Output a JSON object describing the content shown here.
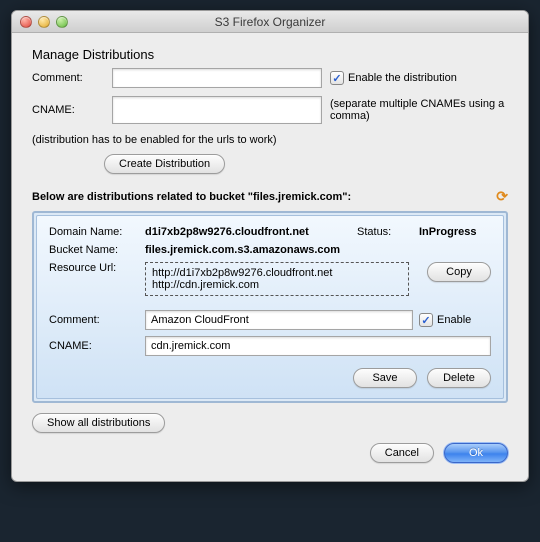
{
  "window": {
    "title": "S3 Firefox Organizer"
  },
  "section": {
    "title": "Manage Distributions"
  },
  "form": {
    "comment_label": "Comment:",
    "comment_value": "",
    "enable_label": "Enable the distribution",
    "cname_label": "CNAME:",
    "cname_value": "",
    "cname_hint": "(separate multiple CNAMEs using a comma)",
    "note": "(distribution has to be enabled for the urls to work)",
    "create_btn": "Create Distribution"
  },
  "list": {
    "title_prefix": "Below are distributions related to bucket \"",
    "bucket": "files.jremick.com",
    "title_suffix": "\":"
  },
  "dist": {
    "domain_label": "Domain Name:",
    "domain_value": "d1i7xb2p8w9276.cloudfront.net",
    "status_label": "Status:",
    "status_value": "InProgress",
    "bucket_label": "Bucket Name:",
    "bucket_value": "files.jremick.com.s3.amazonaws.com",
    "resource_label": "Resource Url:",
    "resource_line1": "http://d1i7xb2p8w9276.cloudfront.net",
    "resource_line2": "http://cdn.jremick.com",
    "copy_btn": "Copy",
    "comment_label": "Comment:",
    "comment_value": "Amazon CloudFront",
    "enable_label": "Enable",
    "cname_label": "CNAME:",
    "cname_value": "cdn.jremick.com",
    "save_btn": "Save",
    "delete_btn": "Delete"
  },
  "footer": {
    "show_all": "Show all distributions",
    "cancel": "Cancel",
    "ok": "Ok"
  }
}
